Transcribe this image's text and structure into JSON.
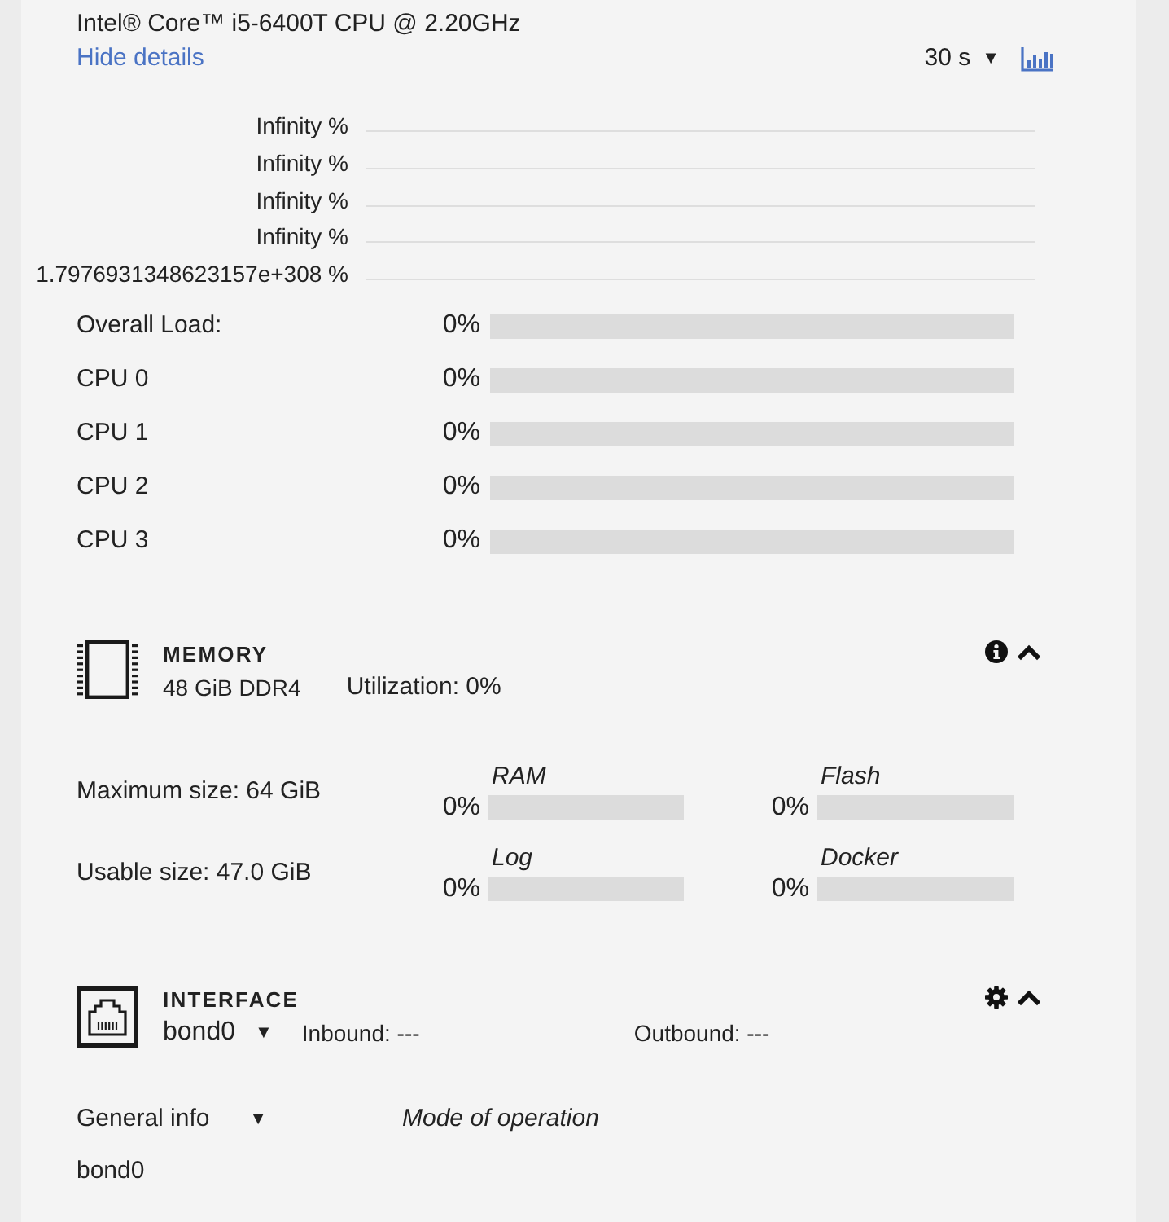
{
  "cpu": {
    "model": "Intel® Core™ i5-6400T CPU @ 2.20GHz",
    "details_link": "Hide details",
    "interval": {
      "value": "30 s",
      "caret": "▼"
    },
    "history_chart": {
      "tick_labels": [
        "Infinity %",
        "Infinity %",
        "Infinity %",
        "Infinity %",
        "1.7976931348623157e+308 %"
      ]
    },
    "loads": [
      {
        "label": "Overall Load:",
        "reading": "0%",
        "level": 0
      },
      {
        "label": "CPU 0",
        "reading": "0%",
        "level": 0
      },
      {
        "label": "CPU 1",
        "reading": "0%",
        "level": 0
      },
      {
        "label": "CPU 2",
        "reading": "0%",
        "level": 0
      },
      {
        "label": "CPU 3",
        "reading": "0%",
        "level": 0
      }
    ]
  },
  "memory": {
    "title": "MEMORY",
    "summary": "48 GiB DDR4",
    "utilization": "Utilization: 0%",
    "expanded": true,
    "rows": [
      {
        "label": "Maximum size: 64 GiB",
        "meters": [
          {
            "name": "RAM",
            "reading": "0%",
            "level": 0
          },
          {
            "name": "Flash",
            "reading": "0%",
            "level": 0
          }
        ]
      },
      {
        "label": "Usable size: 47.0 GiB",
        "meters": [
          {
            "name": "Log",
            "reading": "0%",
            "level": 0
          },
          {
            "name": "Docker",
            "reading": "0%",
            "level": 0
          }
        ]
      }
    ]
  },
  "interface": {
    "title": "INTERFACE",
    "selector": {
      "value": "bond0",
      "caret": "▼"
    },
    "inbound": "Inbound: ---",
    "outbound": "Outbound: ---",
    "expanded": true,
    "view_selector": {
      "value": "General info",
      "caret": "▼"
    },
    "column_heading": "Mode of operation",
    "rows": [
      "bond0"
    ]
  }
}
